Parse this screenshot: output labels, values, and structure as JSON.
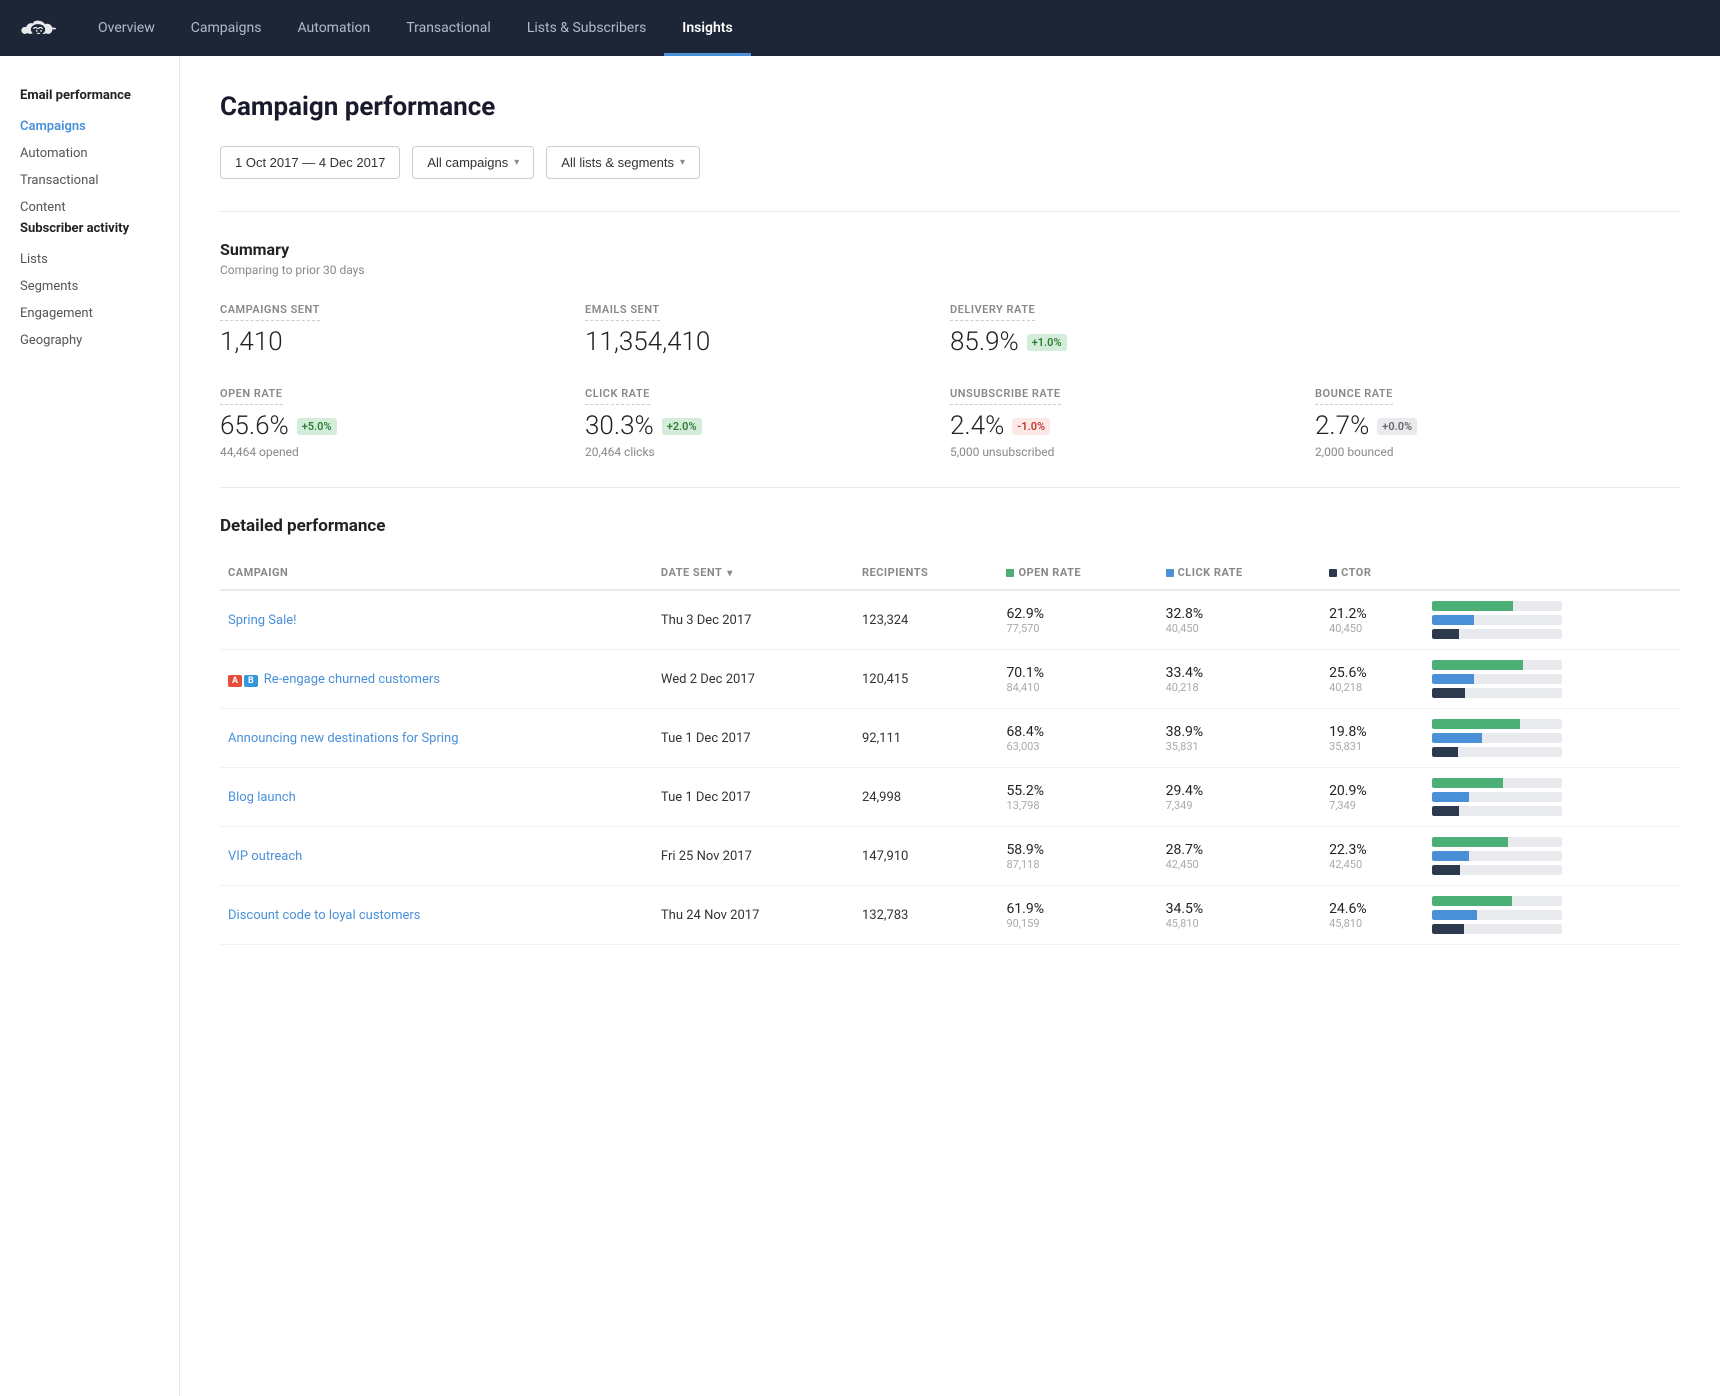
{
  "nav": {
    "logo_alt": "Mailchimp",
    "items": [
      {
        "label": "Overview",
        "active": false
      },
      {
        "label": "Campaigns",
        "active": false
      },
      {
        "label": "Automation",
        "active": false
      },
      {
        "label": "Transactional",
        "active": false
      },
      {
        "label": "Lists & Subscribers",
        "active": false
      },
      {
        "label": "Insights",
        "active": true
      }
    ]
  },
  "sidebar": {
    "sections": [
      {
        "title": "Email performance",
        "items": [
          {
            "label": "Campaigns",
            "active": true
          },
          {
            "label": "Automation",
            "active": false
          },
          {
            "label": "Transactional",
            "active": false
          },
          {
            "label": "Content",
            "active": false
          }
        ]
      },
      {
        "title": "Subscriber activity",
        "items": [
          {
            "label": "Lists",
            "active": false
          },
          {
            "label": "Segments",
            "active": false
          },
          {
            "label": "Engagement",
            "active": false
          },
          {
            "label": "Geography",
            "active": false
          }
        ]
      }
    ]
  },
  "main": {
    "page_title": "Campaign performance",
    "filters": {
      "date_range": "1 Oct 2017 — 4 Dec 2017",
      "campaign_type": "All campaigns",
      "list_segment": "All lists & segments"
    },
    "summary": {
      "title": "Summary",
      "subtitle": "Comparing to prior 30 days",
      "stats_row1": [
        {
          "label": "CAMPAIGNS SENT",
          "value": "1,410",
          "badge": null,
          "sub": null
        },
        {
          "label": "EMAILS SENT",
          "value": "11,354,410",
          "badge": null,
          "sub": null
        },
        {
          "label": "DELIVERY RATE",
          "value": "85.9%",
          "badge": "+1.0%",
          "badge_type": "green",
          "sub": null
        }
      ],
      "stats_row2": [
        {
          "label": "OPEN RATE",
          "value": "65.6%",
          "badge": "+5.0%",
          "badge_type": "green",
          "sub": "44,464 opened"
        },
        {
          "label": "CLICK RATE",
          "value": "30.3%",
          "badge": "+2.0%",
          "badge_type": "green",
          "sub": "20,464 clicks"
        },
        {
          "label": "UNSUBSCRIBE RATE",
          "value": "2.4%",
          "badge": "-1.0%",
          "badge_type": "red",
          "sub": "5,000 unsubscribed"
        },
        {
          "label": "BOUNCE RATE",
          "value": "2.7%",
          "badge": "+0.0%",
          "badge_type": "grey",
          "sub": "2,000 bounced"
        }
      ]
    },
    "detailed": {
      "title": "Detailed performance",
      "columns": [
        "CAMPAIGN",
        "DATE SENT",
        "RECIPIENTS",
        "OPEN RATE",
        "CLICK RATE",
        "CTOR"
      ],
      "rows": [
        {
          "name": "Spring Sale!",
          "ab": false,
          "date": "Thu 3 Dec 2017",
          "recipients": "123,324",
          "open_rate": "62.9%",
          "open_count": "77,570",
          "click_rate": "32.8%",
          "click_count": "40,450",
          "ctor": "21.2%",
          "ctor_count": "40,450",
          "open_bar": 63,
          "click_bar": 33,
          "ctor_bar": 21
        },
        {
          "name": "Re-engage churned customers",
          "ab": true,
          "date": "Wed 2 Dec 2017",
          "recipients": "120,415",
          "open_rate": "70.1%",
          "open_count": "84,410",
          "click_rate": "33.4%",
          "click_count": "40,218",
          "ctor": "25.6%",
          "ctor_count": "40,218",
          "open_bar": 70,
          "click_bar": 33,
          "ctor_bar": 26
        },
        {
          "name": "Announcing new destinations for Spring",
          "ab": false,
          "date": "Tue 1 Dec 2017",
          "recipients": "92,111",
          "open_rate": "68.4%",
          "open_count": "63,003",
          "click_rate": "38.9%",
          "click_count": "35,831",
          "ctor": "19.8%",
          "ctor_count": "35,831",
          "open_bar": 68,
          "click_bar": 39,
          "ctor_bar": 20
        },
        {
          "name": "Blog launch",
          "ab": false,
          "date": "Tue 1 Dec 2017",
          "recipients": "24,998",
          "open_rate": "55.2%",
          "open_count": "13,798",
          "click_rate": "29.4%",
          "click_count": "7,349",
          "ctor": "20.9%",
          "ctor_count": "7,349",
          "open_bar": 55,
          "click_bar": 29,
          "ctor_bar": 21
        },
        {
          "name": "VIP outreach",
          "ab": false,
          "date": "Fri 25 Nov 2017",
          "recipients": "147,910",
          "open_rate": "58.9%",
          "open_count": "87,118",
          "click_rate": "28.7%",
          "click_count": "42,450",
          "ctor": "22.3%",
          "ctor_count": "42,450",
          "open_bar": 59,
          "click_bar": 29,
          "ctor_bar": 22
        },
        {
          "name": "Discount code to loyal customers",
          "ab": false,
          "date": "Thu 24 Nov 2017",
          "recipients": "132,783",
          "open_rate": "61.9%",
          "open_count": "90,159",
          "click_rate": "34.5%",
          "click_count": "45,810",
          "ctor": "24.6%",
          "ctor_count": "45,810",
          "open_bar": 62,
          "click_bar": 35,
          "ctor_bar": 25
        }
      ]
    }
  }
}
